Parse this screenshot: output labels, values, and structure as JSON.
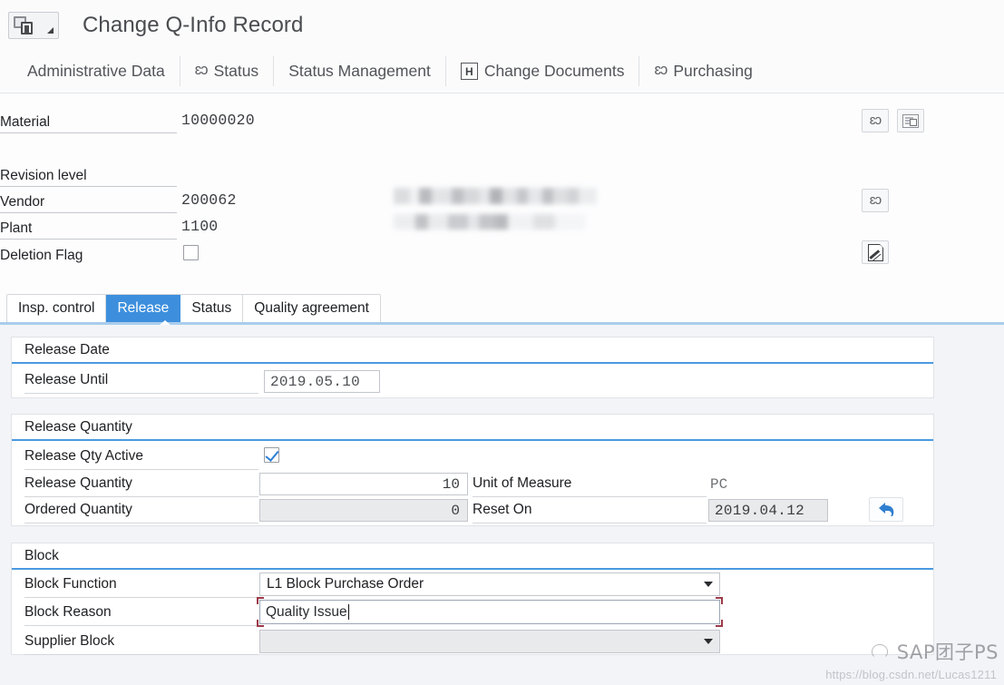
{
  "window": {
    "title": "Change Q-Info Record",
    "app_icon": "q-info-record-icon"
  },
  "navbar": {
    "items": [
      {
        "label": "Administrative Data",
        "icon": null
      },
      {
        "label": "Status",
        "icon": "glasses-icon"
      },
      {
        "label": "Status Management",
        "icon": null
      },
      {
        "label": "Change Documents",
        "icon": "h-document-icon"
      },
      {
        "label": "Purchasing",
        "icon": "glasses-icon"
      }
    ]
  },
  "header_form": {
    "material": {
      "label": "Material",
      "value": "10000020"
    },
    "revision_level": {
      "label": "Revision level",
      "value": ""
    },
    "vendor": {
      "label": "Vendor",
      "value": "200062"
    },
    "plant": {
      "label": "Plant",
      "value": "1100"
    },
    "deletion_flag": {
      "label": "Deletion Flag",
      "checked": false
    },
    "vendor_name_masked": true,
    "side_buttons": [
      {
        "name": "display-vendor-glasses",
        "icon": "glasses-icon"
      },
      {
        "name": "display-material-screen",
        "icon": "screen-icon"
      },
      {
        "name": "display-vendor-glasses-2",
        "icon": "glasses-icon"
      },
      {
        "name": "edit-document-pencil",
        "icon": "pencil-document-icon"
      }
    ]
  },
  "tabs": {
    "items": [
      {
        "label": "Insp. control",
        "active": false
      },
      {
        "label": "Release",
        "active": true
      },
      {
        "label": "Status",
        "active": false
      },
      {
        "label": "Quality agreement",
        "active": false
      }
    ],
    "active_color": "#3d8fdd"
  },
  "groups": {
    "release_date": {
      "title": "Release Date",
      "release_until": {
        "label": "Release Until",
        "value": "2019.05.10"
      }
    },
    "release_quantity": {
      "title": "Release Quantity",
      "release_qty_active": {
        "label": "Release Qty Active",
        "checked": true
      },
      "release_quantity": {
        "label": "Release Quantity",
        "value": "10"
      },
      "ordered_quantity": {
        "label": "Ordered Quantity",
        "value": "0"
      },
      "unit_of_measure": {
        "label": "Unit of Measure",
        "value": "PC"
      },
      "reset_on": {
        "label": "Reset On",
        "value": "2019.04.12"
      },
      "undo_button": {
        "name": "reset-undo-button",
        "icon": "undo-arrow-icon"
      }
    },
    "block": {
      "title": "Block",
      "block_function": {
        "label": "Block Function",
        "value": "L1 Block Purchase Order",
        "options": [
          "L1 Block Purchase Order"
        ]
      },
      "block_reason": {
        "label": "Block Reason",
        "value": "Quality Issue",
        "focused": true
      },
      "supplier_block": {
        "label": "Supplier Block",
        "value": "",
        "options": []
      }
    }
  },
  "watermark": {
    "brand": "SAP团子PS",
    "url": "https://blog.csdn.net/Lucas1211"
  },
  "colors": {
    "accent_blue": "#3d8fdd",
    "group_rule": "#4a9ae0",
    "tab_underline": "#a9cdec",
    "focus_bracket": "#9c3b4a",
    "panel_bg": "#f2f4f7"
  }
}
